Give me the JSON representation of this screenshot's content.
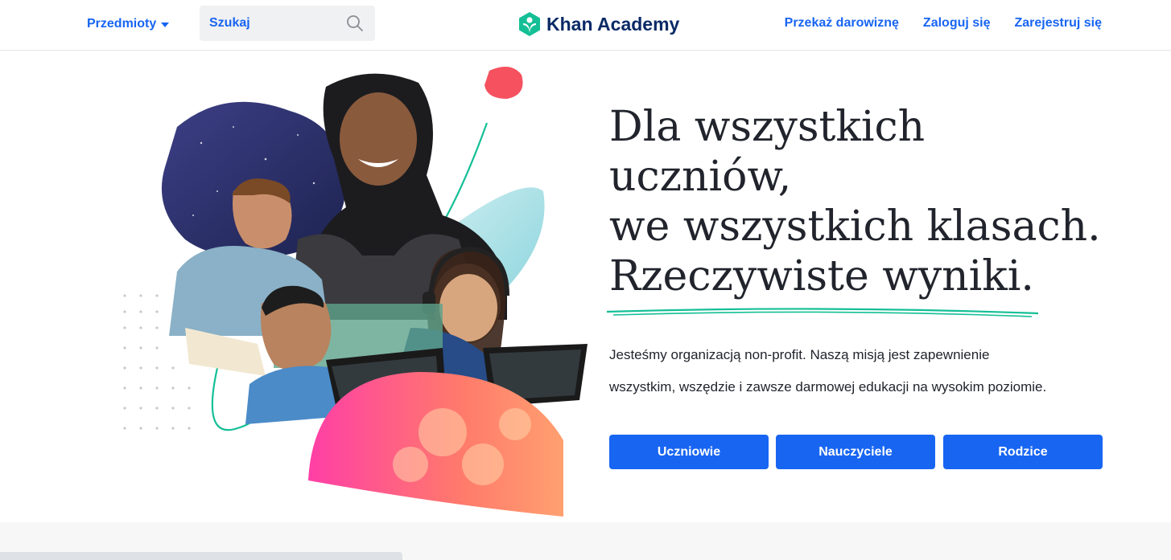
{
  "header": {
    "subjects_label": "Przedmioty",
    "search_placeholder": "Szukaj",
    "logo_text": "Khan Academy",
    "donate_label": "Przekaż darowiznę",
    "login_label": "Zaloguj się",
    "signup_label": "Zarejestruj się"
  },
  "hero": {
    "headline_lines": [
      "Dla wszystkich",
      "uczniów,",
      "we wszystkich klasach.",
      "Rzeczywiste wyniki."
    ],
    "mission_lines": [
      "Jesteśmy organizacją non-profit. Naszą misją jest zapewnienie",
      "wszystkim, wszędzie i zawsze darmowej edukacji na wysokim poziomie."
    ],
    "buttons": [
      "Uczniowie",
      "Nauczyciele",
      "Rodzice"
    ]
  },
  "colors": {
    "accent": "#1865f2",
    "logo_green": "#14bf96",
    "headline": "#21242c"
  },
  "icons": {
    "search": "search-icon",
    "logo": "khan-hexagon-icon",
    "subjects": "caret-down-icon"
  }
}
